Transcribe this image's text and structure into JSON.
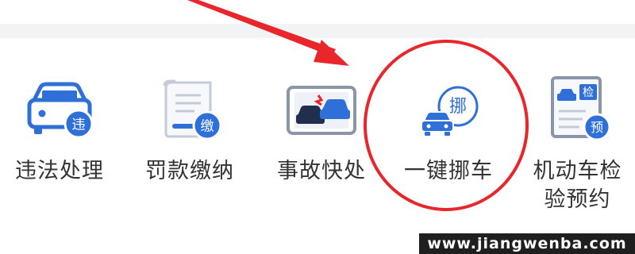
{
  "services": [
    {
      "label": "违法处理",
      "badge": "违",
      "icon": "car-violation-icon"
    },
    {
      "label": "罚款缴纳",
      "badge": "缴",
      "icon": "fine-document-icon"
    },
    {
      "label": "事故快处",
      "icon": "accident-phone-icon"
    },
    {
      "label": "一键挪车",
      "badge": "挪",
      "icon": "move-car-icon"
    },
    {
      "label_line1": "机动车检",
      "label_line2": "验预约",
      "badge": "预",
      "badge_top": "检",
      "icon": "inspection-form-icon"
    }
  ],
  "watermark": "www.jiangwenba.com",
  "colors": {
    "accent": "#2f6fd8",
    "annotation": "#e8262b",
    "text": "#333333"
  }
}
